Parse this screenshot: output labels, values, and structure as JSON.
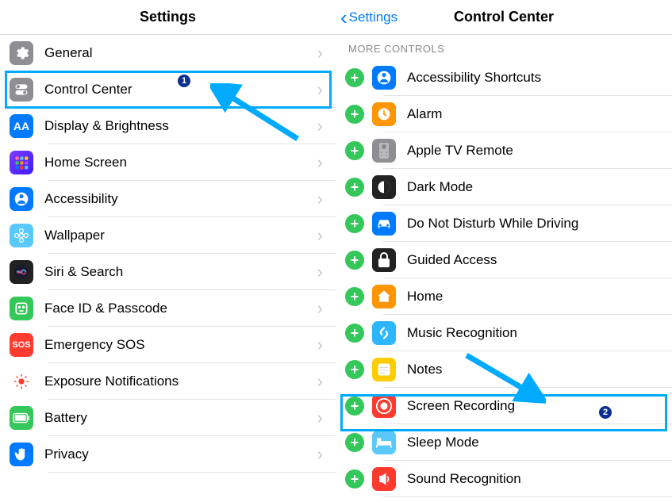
{
  "left": {
    "title": "Settings",
    "items": [
      {
        "label": "General",
        "icon": "gear",
        "color": "grey"
      },
      {
        "label": "Control Center",
        "icon": "switches",
        "color": "grey"
      },
      {
        "label": "Display & Brightness",
        "icon": "aa",
        "color": "blue"
      },
      {
        "label": "Home Screen",
        "icon": "grid",
        "color": "purple"
      },
      {
        "label": "Accessibility",
        "icon": "person",
        "color": "blue"
      },
      {
        "label": "Wallpaper",
        "icon": "flower",
        "color": "teal"
      },
      {
        "label": "Siri & Search",
        "icon": "siri",
        "color": "dark"
      },
      {
        "label": "Face ID & Passcode",
        "icon": "face",
        "color": "green"
      },
      {
        "label": "Emergency SOS",
        "icon": "sos",
        "color": "red"
      },
      {
        "label": "Exposure Notifications",
        "icon": "exposure",
        "color": "pink"
      },
      {
        "label": "Battery",
        "icon": "battery",
        "color": "green"
      },
      {
        "label": "Privacy",
        "icon": "hand",
        "color": "blue"
      }
    ]
  },
  "right": {
    "back_label": "Settings",
    "title": "Control Center",
    "section": "MORE CONTROLS",
    "items": [
      {
        "label": "Accessibility Shortcuts",
        "icon": "person",
        "color": "blue"
      },
      {
        "label": "Alarm",
        "icon": "clock",
        "color": "orange"
      },
      {
        "label": "Apple TV Remote",
        "icon": "remote",
        "color": "grey"
      },
      {
        "label": "Dark Mode",
        "icon": "darkmode",
        "color": "dark"
      },
      {
        "label": "Do Not Disturb While Driving",
        "icon": "car",
        "color": "blue"
      },
      {
        "label": "Guided Access",
        "icon": "lock",
        "color": "dark"
      },
      {
        "label": "Home",
        "icon": "home",
        "color": "orange"
      },
      {
        "label": "Music Recognition",
        "icon": "shazam",
        "color": "cyan"
      },
      {
        "label": "Notes",
        "icon": "notes",
        "color": "yellow"
      },
      {
        "label": "Screen Recording",
        "icon": "record",
        "color": "red"
      },
      {
        "label": "Sleep Mode",
        "icon": "bed",
        "color": "teal"
      },
      {
        "label": "Sound Recognition",
        "icon": "sound",
        "color": "red"
      }
    ]
  },
  "annotations": {
    "badge1": "1",
    "badge2": "2"
  }
}
